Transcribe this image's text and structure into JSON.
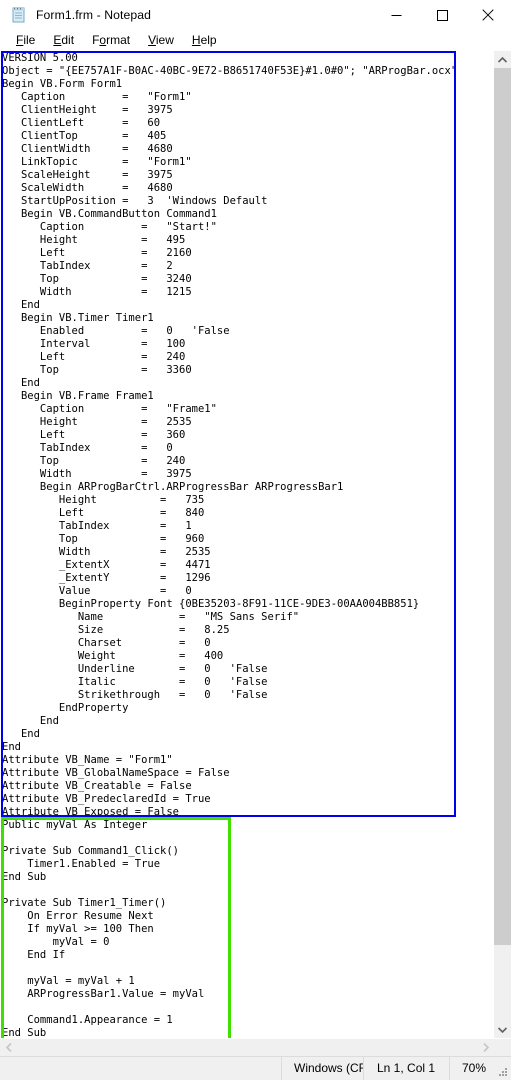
{
  "window": {
    "title": "Form1.frm - Notepad",
    "icon": "notepad-icon",
    "controls": {
      "minimize": "—",
      "maximize": "□",
      "close": "✕"
    }
  },
  "menubar": {
    "items": [
      {
        "name": "file",
        "accel": "F",
        "rest": "ile"
      },
      {
        "name": "edit",
        "accel": "E",
        "rest": "dit"
      },
      {
        "name": "format",
        "accel": "o",
        "pre": "F",
        "rest": "rmat"
      },
      {
        "name": "view",
        "accel": "V",
        "rest": "iew"
      },
      {
        "name": "help",
        "accel": "H",
        "rest": "elp"
      }
    ]
  },
  "editor": {
    "content": "VERSION 5.00\nObject = \"{EE757A1F-B0AC-40BC-9E72-B8651740F53E}#1.0#0\"; \"ARProgBar.ocx\"\nBegin VB.Form Form1\n   Caption         =   \"Form1\"\n   ClientHeight    =   3975\n   ClientLeft      =   60\n   ClientTop       =   405\n   ClientWidth     =   4680\n   LinkTopic       =   \"Form1\"\n   ScaleHeight     =   3975\n   ScaleWidth      =   4680\n   StartUpPosition =   3  'Windows Default\n   Begin VB.CommandButton Command1\n      Caption         =   \"Start!\"\n      Height          =   495\n      Left            =   2160\n      TabIndex        =   2\n      Top             =   3240\n      Width           =   1215\n   End\n   Begin VB.Timer Timer1\n      Enabled         =   0   'False\n      Interval        =   100\n      Left            =   240\n      Top             =   3360\n   End\n   Begin VB.Frame Frame1\n      Caption         =   \"Frame1\"\n      Height          =   2535\n      Left            =   360\n      TabIndex        =   0\n      Top             =   240\n      Width           =   3975\n      Begin ARProgBarCtrl.ARProgressBar ARProgressBar1\n         Height          =   735\n         Left            =   840\n         TabIndex        =   1\n         Top             =   960\n         Width           =   2535\n         _ExtentX        =   4471\n         _ExtentY        =   1296\n         Value           =   0\n         BeginProperty Font {0BE35203-8F91-11CE-9DE3-00AA004BB851}\n            Name            =   \"MS Sans Serif\"\n            Size            =   8.25\n            Charset         =   0\n            Weight          =   400\n            Underline       =   0   'False\n            Italic          =   0   'False\n            Strikethrough   =   0   'False\n         EndProperty\n      End\n   End\nEnd\nAttribute VB_Name = \"Form1\"\nAttribute VB_GlobalNameSpace = False\nAttribute VB_Creatable = False\nAttribute VB_PredeclaredId = True\nAttribute VB_Exposed = False\nPublic myVal As Integer\n\nPrivate Sub Command1_Click()\n    Timer1.Enabled = True\nEnd Sub\n\nPrivate Sub Timer1_Timer()\n    On Error Resume Next\n    If myVal >= 100 Then\n        myVal = 0\n    End If\n\n    myVal = myVal + 1\n    ARProgressBar1.Value = myVal\n\n    Command1.Appearance = 1\nEnd Sub"
  },
  "annotations": {
    "form_block": {
      "color": "#0000ee",
      "label": "form-designer-block-highlight"
    },
    "code_block": {
      "color": "#3fe000",
      "label": "vb-code-block-highlight"
    }
  },
  "statusbar": {
    "line_ending": "Windows (CR",
    "position": "Ln 1, Col 1",
    "zoom": "70%"
  },
  "scrollbars": {
    "vertical": {
      "up": "▲",
      "down": "▼"
    },
    "horizontal": {
      "left": "◀",
      "right": "▶"
    }
  }
}
